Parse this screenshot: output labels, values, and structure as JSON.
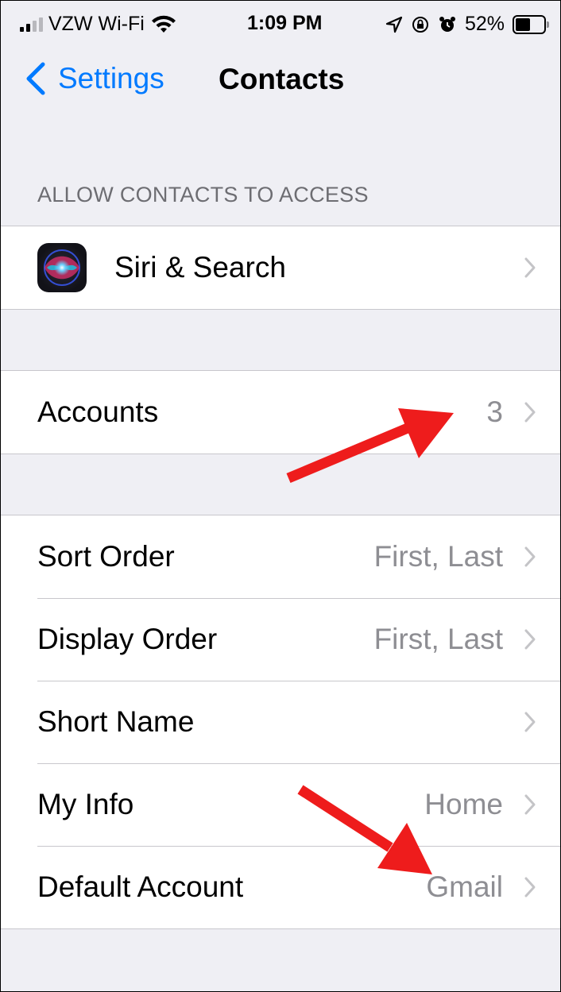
{
  "status_bar": {
    "carrier": "VZW Wi-Fi",
    "time": "1:09 PM",
    "battery": "52%",
    "battery_level": 0.52,
    "icons": [
      "signal-icon",
      "wifi-icon",
      "location-icon",
      "orientation-lock-icon",
      "alarm-icon",
      "battery-icon"
    ]
  },
  "nav": {
    "back_label": "Settings",
    "title": "Contacts"
  },
  "section_header": "ALLOW CONTACTS TO ACCESS",
  "siri_row": {
    "label": "Siri & Search"
  },
  "accounts_row": {
    "label": "Accounts",
    "detail": "3"
  },
  "settings_rows": [
    {
      "label": "Sort Order",
      "detail": "First, Last"
    },
    {
      "label": "Display Order",
      "detail": "First, Last"
    },
    {
      "label": "Short Name",
      "detail": ""
    },
    {
      "label": "My Info",
      "detail": "Home"
    },
    {
      "label": "Default Account",
      "detail": "Gmail"
    }
  ],
  "colors": {
    "accent": "#007aff",
    "background": "#efeff4",
    "detail_text": "#8e8e93",
    "annotation_arrow": "#ee1c1c"
  }
}
